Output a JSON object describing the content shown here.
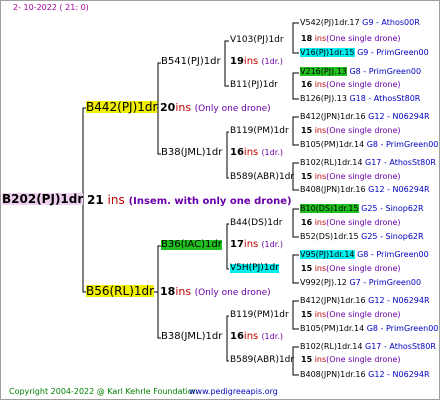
{
  "header": {
    "date": "2- 10-2022 ( 21: 0)"
  },
  "footer": {
    "copyright": "Copyright 2004-2022 @ Karl Kehrle Foundation",
    "url": "www.pedigreeapis.org"
  },
  "gen1": {
    "label": "B202(PJ)1dr",
    "count": "21",
    "ins": "ins",
    "note": "(Insem. with only one drone)"
  },
  "gen2": [
    {
      "label": "B442(PJ)1dr",
      "count": "20",
      "ins": "ins",
      "note": "(Only one drone)"
    },
    {
      "label": "B56(RL)1dr",
      "count": "18",
      "ins": "ins",
      "note": "(Only one drone)"
    }
  ],
  "gen3": [
    {
      "label": "B541(PJ)1dr",
      "count": "19",
      "ins": "ins",
      "note": "(1dr.)"
    },
    {
      "label": "B38(JML)1dr",
      "count": "16",
      "ins": "ins",
      "note": "(1dr.)"
    },
    {
      "label": "B36(IAC)1dr",
      "count": "17",
      "ins": "ins",
      "note": "(1dr.)"
    },
    {
      "label": "B38(JML)1dr",
      "count": "16",
      "ins": "ins",
      "note": "(1dr.)"
    }
  ],
  "gen4": [
    {
      "label": "V103(PJ)1dr",
      "count": "18",
      "ins": "ins",
      "note": "(One single drone)"
    },
    {
      "label": "B11(PJ)1dr",
      "count": "16",
      "ins": "ins",
      "note": "(One single drone)"
    },
    {
      "label": "B119(PM)1dr",
      "count": "15",
      "ins": "ins",
      "note": "(One single drone)"
    },
    {
      "label": "B589(ABR)1dr",
      "count": "15",
      "ins": "ins",
      "note": "(One single drone)"
    },
    {
      "label": "B44(DS)1dr",
      "count": "16",
      "ins": "ins",
      "note": "(One single drone)"
    },
    {
      "label": "V5H(PJ)1dr",
      "count": "15",
      "ins": "ins",
      "note": "(One single drone)"
    },
    {
      "label": "B119(PM)1dr",
      "count": "15",
      "ins": "ins",
      "note": "(One single drone)"
    },
    {
      "label": "B589(ABR)1dr",
      "count": "15",
      "ins": "ins",
      "note": "(One single drone)"
    }
  ],
  "gen5": [
    {
      "label": "V542(PJ)1dr.17",
      "code": "G9 - Athos00R"
    },
    {
      "label": "V16(PJ)1dr.15",
      "code": "G9 - PrimGreen00"
    },
    {
      "label": "V216(PJ).13",
      "code": "G8 - PrimGreen00"
    },
    {
      "label": "B126(PJ).13",
      "code": "G18 - AthosSt80R"
    },
    {
      "label": "B412(JPN)1dr.16",
      "code": "G12 - N06294R"
    },
    {
      "label": "B105(PM)1dr.14",
      "code": "G8 - PrimGreen00"
    },
    {
      "label": "B102(RL)1dr.14",
      "code": "G17 - AthosSt80R"
    },
    {
      "label": "B408(JPN)1dr.16",
      "code": "G12 - N06294R"
    },
    {
      "label": "B10(DS)1dr.15",
      "code": "G25 - Sinop62R"
    },
    {
      "label": "B52(DS)1dr.15",
      "code": "G25 - Sinop62R"
    },
    {
      "label": "V95(PJ)1dr.14",
      "code": "G8 - PrimGreen00"
    },
    {
      "label": "V992(PJ).12",
      "code": "G7 - PrimGreen00"
    },
    {
      "label": "B412(JPN)1dr.16",
      "code": "G12 - N06294R"
    },
    {
      "label": "B105(PM)1dr.14",
      "code": "G8 - PrimGreen00"
    },
    {
      "label": "B102(RL)1dr.14",
      "code": "G17 - AthosSt80R"
    },
    {
      "label": "B408(JPN)1dr.16",
      "code": "G12 - N06294R"
    }
  ],
  "colors": {
    "tree_line": "#000000",
    "ins": "#c00000",
    "note": "#6a00a8",
    "code": "#0000c0",
    "highlight_yellow": "#f0f000",
    "highlight_green": "#20c020",
    "highlight_cyan": "#00f0f0",
    "highlight_pink": "#f0d0f0"
  }
}
